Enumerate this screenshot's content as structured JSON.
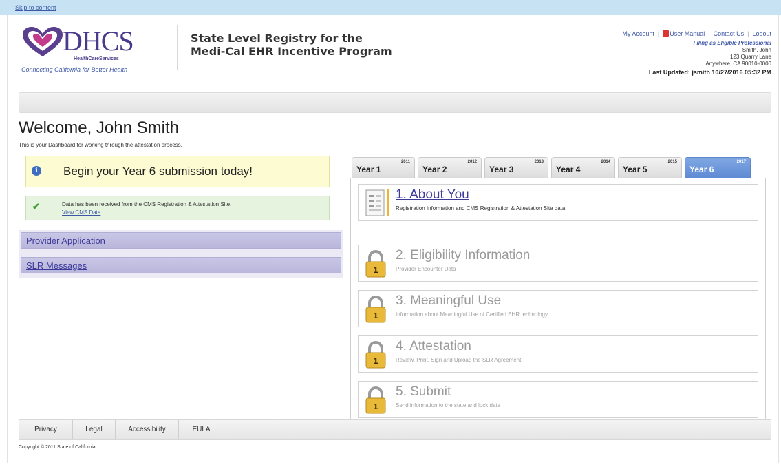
{
  "skip_link": "Skip to content",
  "header": {
    "logo_text": "DHCS",
    "logo_sub": "HealthCareServices",
    "tagline": "Connecting California for Better Health",
    "title_line1": "State Level Registry for the",
    "title_line2": "Medi-Cal EHR Incentive Program",
    "links": {
      "my_account": "My Account",
      "user_manual": "User Manual",
      "contact_us": "Contact Us",
      "logout": "Logout"
    },
    "user": {
      "filing_as": "Filing as Eligible Professional",
      "name": "Smith, John",
      "address1": "123 Quarry Lane",
      "address2": "Anywhere, CA 90010-0000",
      "last_updated": "Last Updated: jsmith 10/27/2016 05:32 PM"
    }
  },
  "welcome": {
    "title": "Welcome, John Smith",
    "subtitle": "This is your Dashboard for working through the attestation process."
  },
  "notice": {
    "text": "Begin your Year 6 submission today!"
  },
  "cms": {
    "text": "Data has been received from the CMS Registration & Attestation Site.",
    "link": "View CMS Data"
  },
  "leftnav": {
    "items": [
      {
        "label": "Provider Application"
      },
      {
        "label": "SLR Messages"
      }
    ]
  },
  "tabs": [
    {
      "label": "Year 1",
      "year": "2011"
    },
    {
      "label": "Year 2",
      "year": "2012"
    },
    {
      "label": "Year 3",
      "year": "2013"
    },
    {
      "label": "Year 4",
      "year": "2014"
    },
    {
      "label": "Year 5",
      "year": "2015"
    },
    {
      "label": "Year 6",
      "year": "2017"
    }
  ],
  "active_tab": "Year 6",
  "steps": [
    {
      "title": "1. About You",
      "desc": "Registration Information and CMS Registration & Attestation Site data",
      "icon": "document-icon",
      "active": true
    },
    {
      "title": "2. Eligibility Information",
      "desc": "Provider Encounter Data",
      "icon": "lock-icon",
      "active": false
    },
    {
      "title": "3. Meaningful Use",
      "desc": "Information about Meaningful Use of Certified EHR technology.",
      "icon": "lock-icon",
      "active": false
    },
    {
      "title": "4. Attestation",
      "desc": "Review, Print, Sign and Upload the SLR Agreement",
      "icon": "lock-icon",
      "active": false
    },
    {
      "title": "5. Submit",
      "desc": "Send information to the state and lock data",
      "icon": "lock-icon",
      "active": false
    }
  ],
  "footer": {
    "links": [
      "Privacy",
      "Legal",
      "Accessibility",
      "EULA"
    ],
    "copyright": "Copyright © 2011 State of California"
  },
  "colors": {
    "brand_purple": "#4a3a8c",
    "active_tab": "#6b95da",
    "notice_bg": "#fdfbd2",
    "success_bg": "#e6f3de",
    "nav_bg": "#c9c7e6",
    "lock_gold": "#e9b93a"
  }
}
